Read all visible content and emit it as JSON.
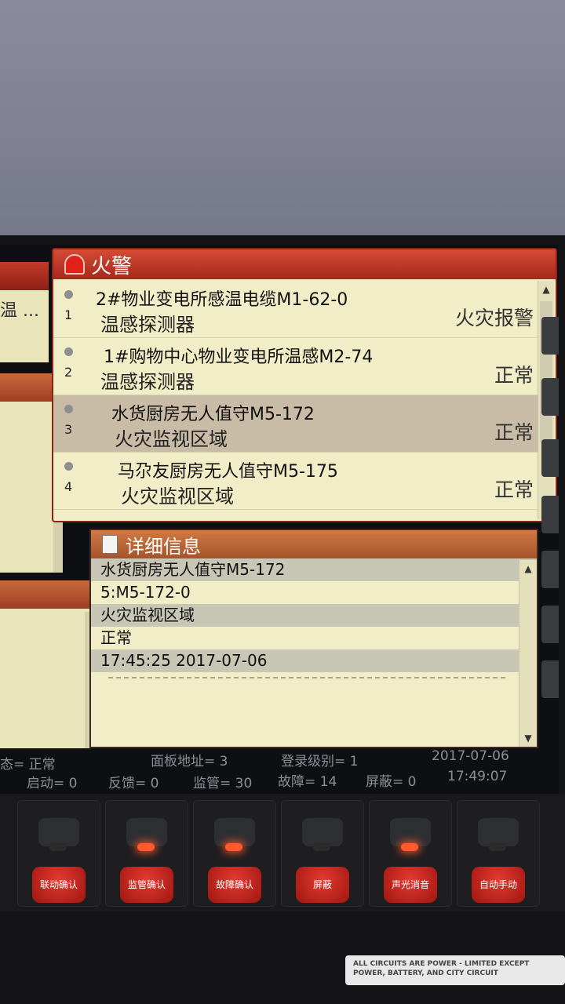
{
  "fire_panel": {
    "title": "火警",
    "rows": [
      {
        "index": "1",
        "name": "2#物业变电所感温电缆M1-62-0",
        "type": "温感探测器",
        "status": "火灾报警"
      },
      {
        "index": "2",
        "name": "1#购物中心物业变电所温感M2-74",
        "type": "温感探测器",
        "status": "正常"
      },
      {
        "index": "3",
        "name": "水货厨房无人值守M5-172",
        "type": "火灾监视区域",
        "status": "正常"
      },
      {
        "index": "4",
        "name": "马尕友厨房无人值守M5-175",
        "type": "火灾监视区域",
        "status": "正常"
      }
    ]
  },
  "left_stub": {
    "text": "温 ..."
  },
  "detail_panel": {
    "title": "详细信息",
    "lines": [
      "水货厨房无人值守M5-172",
      "5:M5-172-0",
      "火灾监视区域",
      "正常",
      "17:45:25  2017-07-06"
    ]
  },
  "status_bar": {
    "state": "态= 正常",
    "panel_addr": "面板地址= 3",
    "login_level": "登录级别= 1",
    "date": "2017-07-06",
    "start": "启动= 0",
    "feedback": "反馈= 0",
    "supervise": "监管= 30",
    "fault": "故障= 14",
    "shield": "屏蔽= 0",
    "time": "17:49:07"
  },
  "keys": [
    {
      "label": "联动确认",
      "led": false
    },
    {
      "label": "监管确认",
      "led": true
    },
    {
      "label": "故障确认",
      "led": true
    },
    {
      "label": "屏蔽",
      "led": false
    },
    {
      "label": "声光消音",
      "led": true
    },
    {
      "label": "自动手动",
      "led": false
    }
  ],
  "device_label": {
    "line1": "ALL CIRCUITS ARE POWER - LIMITED EXCEPT",
    "line2": "POWER, BATTERY, AND CITY CIRCUIT"
  },
  "colors": {
    "alarm_red": "#a5291c",
    "panel_bg": "#f1edc6",
    "led_on": "#ff5a2c"
  }
}
